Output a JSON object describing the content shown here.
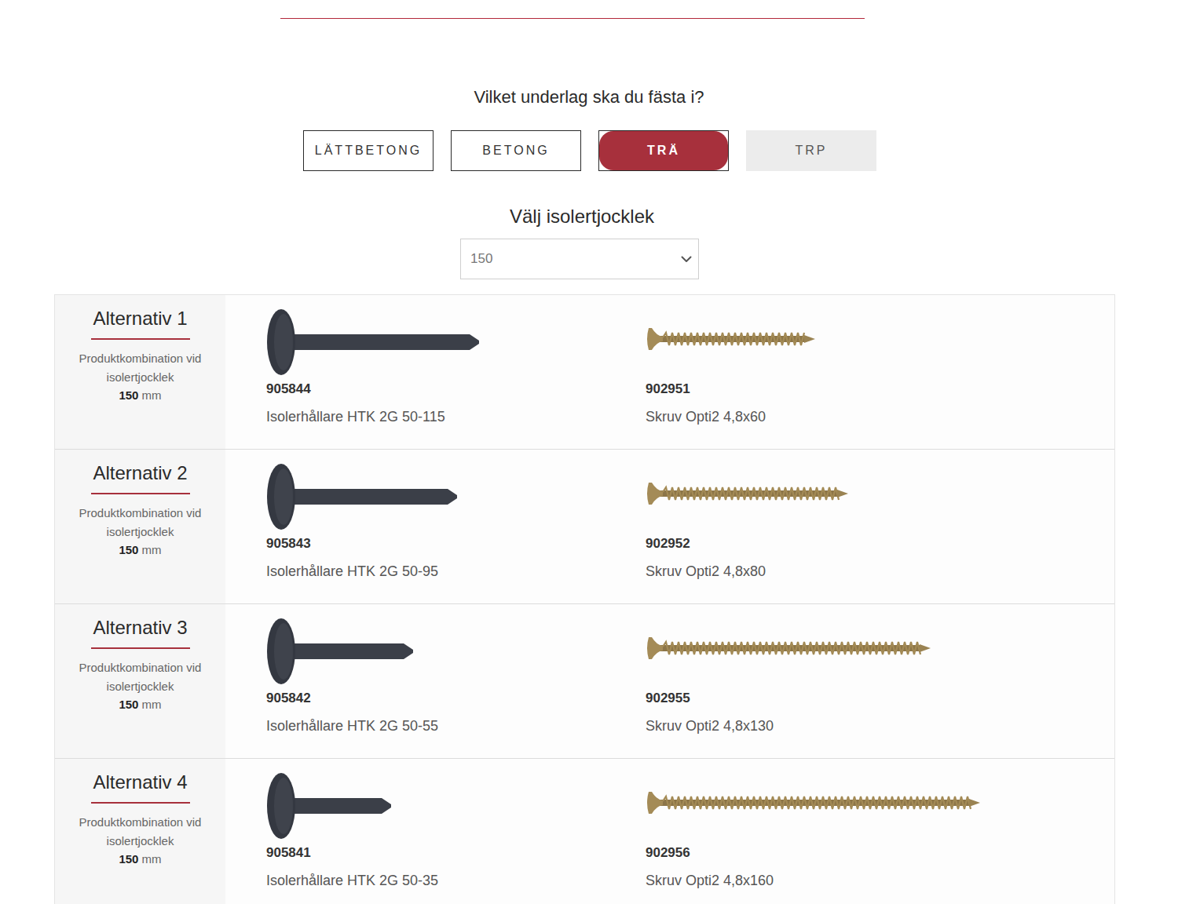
{
  "question": "Vilket underlag ska du fästa i?",
  "substrates": [
    {
      "label": "LÄTTBETONG",
      "selected": false,
      "disabled": false
    },
    {
      "label": "BETONG",
      "selected": false,
      "disabled": false
    },
    {
      "label": "TRÄ",
      "selected": true,
      "disabled": false
    },
    {
      "label": "TRP",
      "selected": false,
      "disabled": true
    }
  ],
  "thickness": {
    "label": "Välj isolertjocklek",
    "value": "150"
  },
  "alternatives": [
    {
      "title": "Alternativ 1",
      "description": "Produktkombination vid isolertjocklek",
      "thickness": "150",
      "unit": "mm",
      "holder": {
        "code": "905844",
        "name": "Isolerhållare HTK 2G 50-115"
      },
      "screw": {
        "code": "902951",
        "name": "Skruv Opti2 4,8x60"
      }
    },
    {
      "title": "Alternativ 2",
      "description": "Produktkombination vid isolertjocklek",
      "thickness": "150",
      "unit": "mm",
      "holder": {
        "code": "905843",
        "name": "Isolerhållare HTK 2G 50-95"
      },
      "screw": {
        "code": "902952",
        "name": "Skruv Opti2 4,8x80"
      }
    },
    {
      "title": "Alternativ 3",
      "description": "Produktkombination vid isolertjocklek",
      "thickness": "150",
      "unit": "mm",
      "holder": {
        "code": "905842",
        "name": "Isolerhållare HTK 2G 50-55"
      },
      "screw": {
        "code": "902955",
        "name": "Skruv Opti2 4,8x130"
      }
    },
    {
      "title": "Alternativ 4",
      "description": "Produktkombination vid isolertjocklek",
      "thickness": "150",
      "unit": "mm",
      "holder": {
        "code": "905841",
        "name": "Isolerhållare HTK 2G 50-35"
      },
      "screw": {
        "code": "902956",
        "name": "Skruv Opti2 4,8x160"
      }
    }
  ]
}
